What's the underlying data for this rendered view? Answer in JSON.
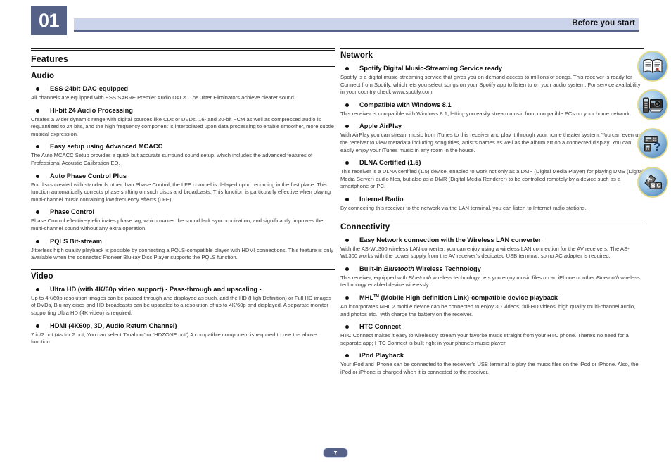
{
  "header": {
    "chapter_number": "01",
    "title": "Before you start"
  },
  "footer": {
    "page_number": "7"
  },
  "colors": {
    "chapter_box": "#566188",
    "header_band": "#ccd4ec",
    "header_rule": "#566188"
  },
  "left_column": {
    "major_heading": "Features",
    "sections": [
      {
        "heading": "Audio",
        "items": [
          {
            "title": "ESS-24bit-DAC-equipped",
            "body": "All channels are equipped with ESS SABRE Premier Audio DACs. The Jitter Eliminators achieve clearer sound."
          },
          {
            "title": "Hi-bit 24 Audio Processing",
            "body": "Creates a wider dynamic range with digital sources like CDs or DVDs. 16- and 20-bit PCM as well as compressed audio is requantized to 24 bits, and the high frequency component is interpolated upon data processing to enable smoother, more subtle musical expression."
          },
          {
            "title": "Easy setup using Advanced MCACC",
            "body": "The Auto MCACC Setup provides a quick but accurate surround sound setup, which includes the advanced features of Professional Acoustic Calibration EQ."
          },
          {
            "title": "Auto Phase Control Plus",
            "body": "For discs created with standards other than Phase Control, the LFE channel is delayed upon recording in the first place. This function automatically corrects phase shifting on such discs and broadcasts. This function is particularly effective when playing multi-channel music containing low frequency effects (LFE)."
          },
          {
            "title": "Phase Control",
            "body": "Phase Control effectively eliminates phase lag, which makes the sound lack synchronization, and significantly improves the multi-channel sound without any extra operation."
          },
          {
            "title": "PQLS Bit-stream",
            "body": "Jitterless high quality playback is possible by connecting a PQLS-compatible player with HDMI connections. This feature is only available when the connected Pioneer Blu-ray Disc Player supports the PQLS function."
          }
        ]
      },
      {
        "heading": "Video",
        "items": [
          {
            "title": "Ultra HD (with 4K/60p video support) - Pass-through and upscaling -",
            "body": "Up to 4K/60p resolution images can be passed through and displayed as such, and the HD (High Definition) or Full HD images of DVDs, Blu-ray discs and HD broadcasts can be upscaled to a resolution of up to 4K/60p and displayed. A separate monitor supporting Ultra HD (4K video) is required."
          },
          {
            "title": "HDMI (4K60p, 3D, Audio Return Channel)",
            "body": "7 in/2 out (As for 2 out; You can select ‘Dual out’ or ‘HDZONE out’) A compatible component is required to use the above function."
          }
        ]
      }
    ]
  },
  "right_column": {
    "sections": [
      {
        "heading": "Network",
        "items": [
          {
            "title": "Spotify Digital Music-Streaming Service ready",
            "body": "Spotify is a digital music-streaming service that gives you on-demand access to millions of songs. This receiver is ready for Connect from Spotify, which lets you select songs on your Spotify app to listen to on your audio system. For service availability in your country check www.spotify.com."
          },
          {
            "title": "Compatible with Windows 8.1",
            "body": "This receiver is compatible with Windows 8.1, letting you easily stream music from compatible PCs on your home network."
          },
          {
            "title": "Apple AirPlay",
            "body": "With AirPlay you can stream music from iTunes to this receiver and play it through your home theater system. You can even use the receiver to view metadata including song titles, artist’s names as well as the album art on a connected display. You can easily enjoy your iTunes music in any room in the house."
          },
          {
            "title": "DLNA Certified (1.5)",
            "body": "This receiver is a DLNA certified (1.5) device, enabled to work not only as a DMP (Digital Media Player) for playing DMS (Digital Media Server) audio files, but also as a DMR (Digital Media Renderer) to be controlled remotely by a device such as a smartphone or PC."
          },
          {
            "title": "Internet Radio",
            "body": "By connecting this receiver to the network via the LAN terminal, you can listen to Internet radio stations."
          }
        ]
      },
      {
        "heading": "Connectivity",
        "items": [
          {
            "title": "Easy Network connection with the Wireless LAN converter",
            "body": "With the AS-WL300 wireless LAN converter, you can enjoy using a wireless LAN connection for the AV receivers. The AS-WL300 works with the power supply from the AV receiver’s dedicated USB terminal, so no AC adapter is required."
          },
          {
            "title_parts": [
              {
                "text": "Built-in ",
                "style": "normal"
              },
              {
                "text": "Bluetooth",
                "style": "italic"
              },
              {
                "text": " Wireless Technology",
                "style": "normal"
              }
            ],
            "title": "Built-in Bluetooth Wireless Technology",
            "body_parts": [
              {
                "text": "This receiver, equipped with ",
                "style": "normal"
              },
              {
                "text": "Bluetooth",
                "style": "italic"
              },
              {
                "text": " wireless technology, lets you enjoy music files on an iPhone or other ",
                "style": "normal"
              },
              {
                "text": "Bluetooth",
                "style": "italic"
              },
              {
                "text": " wireless technology enabled device wirelessly.",
                "style": "normal"
              }
            ],
            "body": "This receiver, equipped with Bluetooth wireless technology, lets you enjoy music files on an iPhone or other Bluetooth wireless technology enabled device wirelessly."
          },
          {
            "title_parts": [
              {
                "text": "MHL",
                "style": "normal"
              },
              {
                "text": "TM",
                "style": "sup"
              },
              {
                "text": " (Mobile High-definition Link)-compatible device playback",
                "style": "normal"
              }
            ],
            "title": "MHL™ (Mobile High-definition Link)-compatible device playback",
            "body": "An incorporates MHL 2 mobile device can be connected to enjoy 3D videos, full-HD videos, high quality multi-channel audio, and photos etc., with charge the battery on the receiver."
          },
          {
            "title": "HTC Connect",
            "body": "HTC Connect makes it easy to wirelessly stream your favorite music straight from your HTC phone. There’s no need for a separate app; HTC Connect is built right in your phone’s music player."
          },
          {
            "title": "iPod Playback",
            "body": "Your iPod and iPhone can be connected to the receiver’s USB terminal to play the music files on the iPod or iPhone. Also, the iPod or iPhone is charged when it is connected to the receiver."
          }
        ]
      }
    ]
  },
  "side_icons": [
    {
      "name": "open-book-icon"
    },
    {
      "name": "remote-and-receiver-icon"
    },
    {
      "name": "question-troubleshooting-icon"
    },
    {
      "name": "abc-glossary-icon"
    }
  ]
}
